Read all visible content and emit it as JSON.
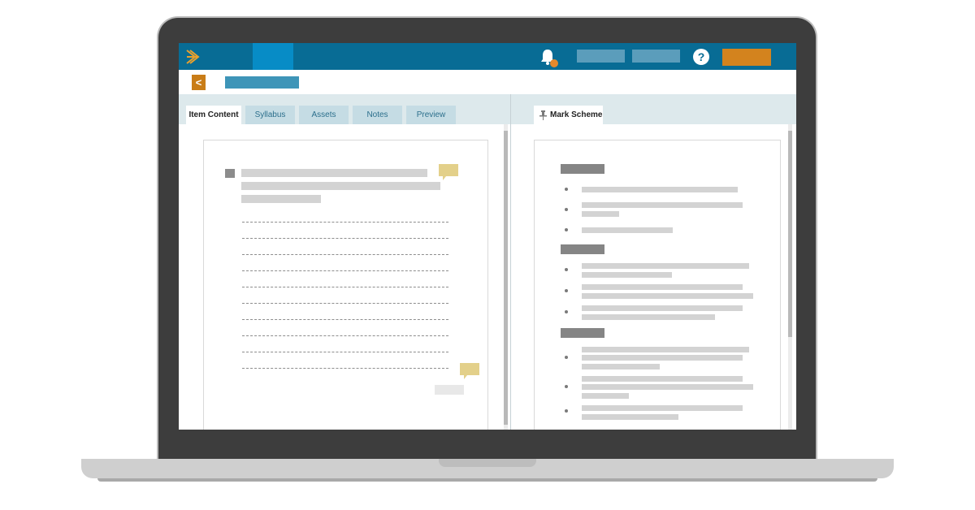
{
  "tabs": {
    "item_content": "Item Content",
    "syllabus": "Syllabus",
    "assets": "Assets",
    "notes": "Notes",
    "preview": "Preview"
  },
  "mark_scheme_tab": "Mark Scheme",
  "header": {
    "help_symbol": "?",
    "back_symbol": "<"
  },
  "colors": {
    "brand": "#086c95",
    "accent": "#d3831e",
    "notification": "#e6892c",
    "comment": "#e3d08a"
  },
  "icons": {
    "logo": "chevron-logo-icon",
    "bell": "bell-icon",
    "help": "help-icon",
    "back": "chevron-left-icon",
    "pin": "pin-icon",
    "comment": "comment-icon"
  }
}
